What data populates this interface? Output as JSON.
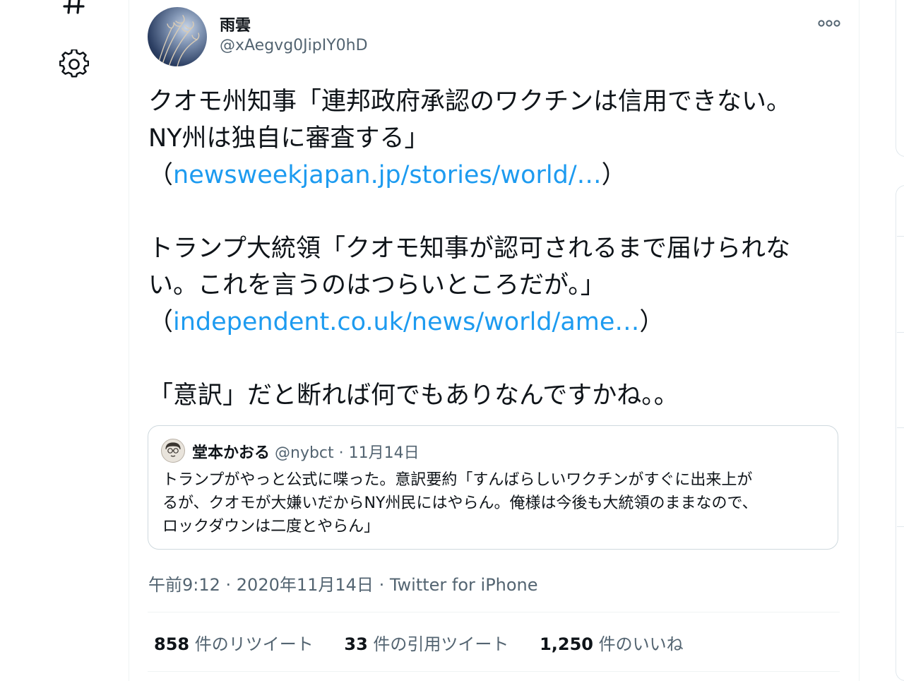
{
  "nav": {
    "icons": [
      "hashtag-icon",
      "settings-icon"
    ]
  },
  "tweet": {
    "display_name": "雨雲",
    "handle": "@xAegvg0JipIY0hD",
    "lines": {
      "l1": "クオモ州知事「連邦政府承認のワクチンは信用できない。",
      "l2": "NY州は独自に審査する」",
      "l3_open": "（",
      "l3_link": "newsweekjapan.jp/stories/world/…",
      "l3_close": "）",
      "l4": "トランプ大統領「クオモ知事が認可されるまで届けられな",
      "l5": "い。これを言うのはつらいところだが。」",
      "l6_open": "（",
      "l6_link": "independent.co.uk/news/world/ame…",
      "l6_close": "）",
      "l7": "「意訳」だと断れば何でもありなんですかね。。"
    },
    "quote": {
      "name": "堂本かおる",
      "meta": " @nybct · 11月14日",
      "lines": {
        "l1": "トランプがやっと公式に喋った。意訳要約「すんばらしいワクチンがすぐに出来上が",
        "l2": "るが、クオモが大嫌いだからNY州民にはやらん。俺様は今後も大統領のままなので、",
        "l3": "ロックダウンは二度とやらん」"
      }
    },
    "timestamp": "午前9:12 · 2020年11月14日 · ",
    "source": "Twitter for iPhone",
    "stats": {
      "retweets_num": "858",
      "retweets_label": " 件のリツイート",
      "quotes_num": "33",
      "quotes_label": " 件の引用ツイート",
      "likes_num": "1,250",
      "likes_label": " 件のいいね"
    }
  },
  "colors": {
    "link": "#1d9bf0",
    "secondary_text": "#536471",
    "primary_text": "#0f1419",
    "border": "#cfd9de"
  }
}
